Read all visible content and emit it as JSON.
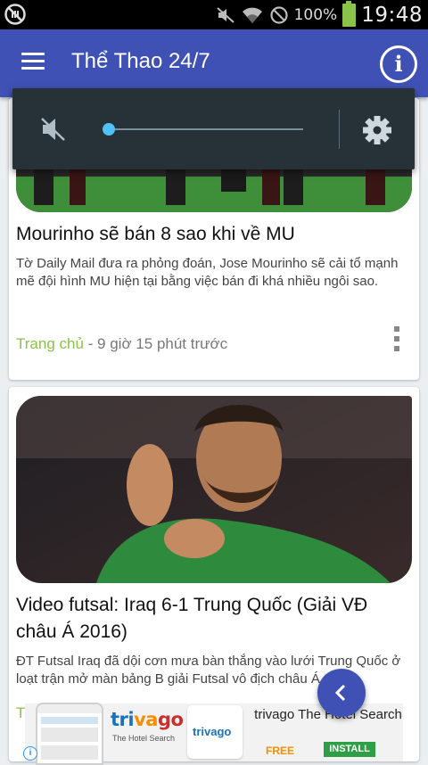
{
  "status_bar": {
    "battery_percent": "100%",
    "time": "19:48",
    "icons": [
      "sync-disabled-icon",
      "mute-icon",
      "wifi-icon",
      "no-signal-icon",
      "battery-icon"
    ]
  },
  "app_bar": {
    "title": "Thể Thao 24/7",
    "menu_icon": "menu-icon",
    "info_icon": "info-icon",
    "info_glyph": "i"
  },
  "volume_panel": {
    "level": 0,
    "muted": true,
    "accent": "#4fc3f7"
  },
  "articles": [
    {
      "title": "Mourinho sẽ bán 8 sao khi về MU",
      "description": "Tờ Daily Mail đưa ra phỏng đoán, Jose Mourinho sẽ cải tổ mạnh mẽ đội hình MU hiện tại bằng việc bán đi khá nhiều ngôi sao.",
      "source": "Trang chủ",
      "time": " - 9 giờ 15 phút trước"
    },
    {
      "title": "Video futsal: Iraq 6-1 Trung Quốc (Giải VĐ châu Á 2016)",
      "description": "ĐT Futsal Iraq đã dội cơn mưa bàn thắng vào lưới Trung Quốc ở loạt trận mở màn bảng B giải Futsal vô địch châu Á 2016",
      "source": "T"
    }
  ],
  "ad": {
    "brand_parts": [
      "tri",
      "va",
      "go"
    ],
    "brand_sub": "The Hotel Search",
    "logo_text": "trivago",
    "headline": "trivago The Hotel Search",
    "price": "FREE",
    "install_label": "INSTALL",
    "info_glyph": "i"
  },
  "colors": {
    "primary": "#3f51b5",
    "source_green": "#8bc34a",
    "background": "#eceff1"
  }
}
